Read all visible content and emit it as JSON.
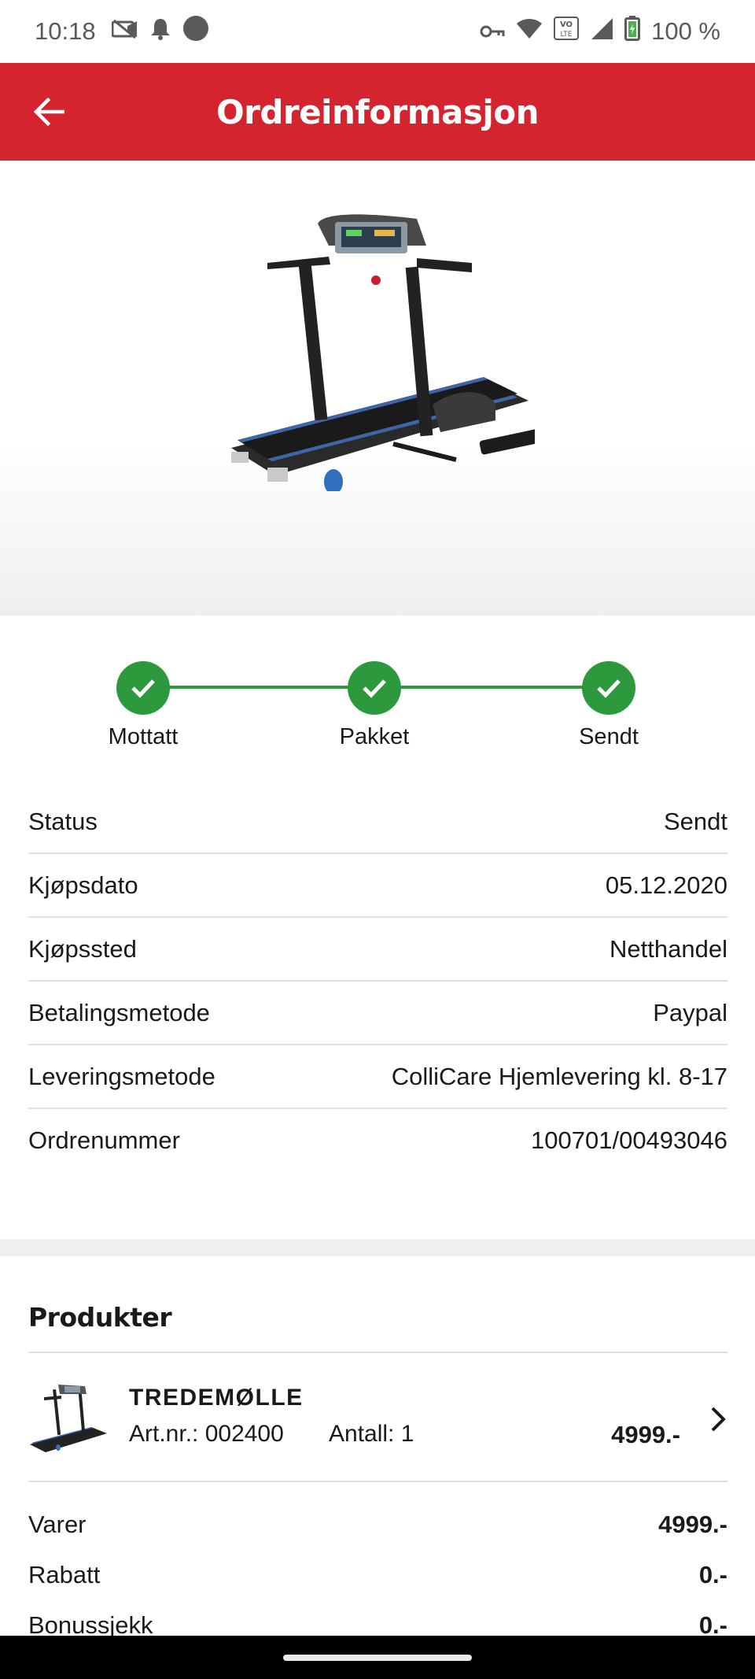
{
  "status_bar": {
    "time": "10:18",
    "battery": "100 %",
    "icons_left": [
      "screen-record-icon",
      "notification-bell-icon",
      "dot-icon"
    ],
    "icons_right": [
      "vpn-key-icon",
      "wifi-icon",
      "volte-icon",
      "signal-icon",
      "battery-icon"
    ]
  },
  "app_bar": {
    "title": "Ordreinformasjon",
    "back_icon": "arrow-back-icon",
    "color": "#d32430"
  },
  "hero": {
    "image": "treadmill-product-image"
  },
  "progress": {
    "color": "#2c9a3c",
    "steps": [
      {
        "label": "Mottatt",
        "done": true
      },
      {
        "label": "Pakket",
        "done": true
      },
      {
        "label": "Sendt",
        "done": true
      }
    ]
  },
  "info": {
    "rows": [
      {
        "label": "Status",
        "value": "Sendt"
      },
      {
        "label": "Kjøpsdato",
        "value": "05.12.2020"
      },
      {
        "label": "Kjøpssted",
        "value": "Netthandel"
      },
      {
        "label": "Betalingsmetode",
        "value": "Paypal"
      },
      {
        "label": "Leveringsmetode",
        "value": "ColliCare Hjemlevering kl. 8-17"
      },
      {
        "label": "Ordrenummer",
        "value": "100701/00493046"
      }
    ]
  },
  "products": {
    "heading": "Produkter",
    "items": [
      {
        "name": "TREDEMØLLE",
        "artnr": "Art.nr.: 002400",
        "qty": "Antall: 1",
        "price": "4999.-"
      }
    ]
  },
  "totals": [
    {
      "label": "Varer",
      "value": "4999.-"
    },
    {
      "label": "Rabatt",
      "value": "0.-"
    },
    {
      "label": "Bonussjekk",
      "value": "0.-"
    }
  ]
}
